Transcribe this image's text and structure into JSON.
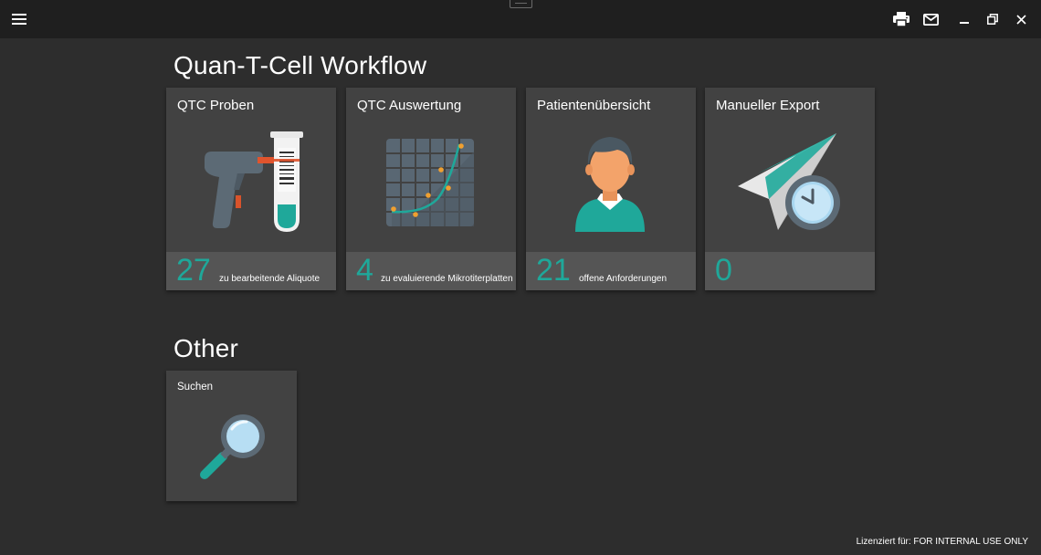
{
  "titlebar": {
    "menu_icon": "hamburger-icon",
    "actions": [
      {
        "name": "print-icon"
      },
      {
        "name": "mail-icon"
      },
      {
        "name": "minimize-icon"
      },
      {
        "name": "restore-icon"
      },
      {
        "name": "close-icon"
      }
    ]
  },
  "sections": {
    "workflow": {
      "title": "Quan-T-Cell Workflow",
      "tiles": [
        {
          "title": "QTC Proben",
          "count": "27",
          "subtitle": "zu bearbeitende Aliquote",
          "icon": "barcode-scanner-test-tube-icon"
        },
        {
          "title": "QTC Auswertung",
          "count": "4",
          "subtitle": "zu evaluierende Mikrotiterplatten",
          "icon": "chart-grid-icon"
        },
        {
          "title": "Patientenübersicht",
          "count": "21",
          "subtitle": "offene Anforderungen",
          "icon": "patient-avatar-icon"
        },
        {
          "title": "Manueller Export",
          "count": "0",
          "subtitle": "",
          "icon": "paper-plane-clock-icon"
        }
      ]
    },
    "other": {
      "title": "Other",
      "tiles": [
        {
          "title": "Suchen",
          "icon": "magnifier-icon"
        }
      ]
    }
  },
  "footer": {
    "license": "Lizenziert für: FOR INTERNAL USE ONLY"
  },
  "colors": {
    "background": "#2d2d2d",
    "titlebar": "#1f1f1f",
    "tile": "#424242",
    "tile_footer": "#555555",
    "accent": "#1fa89a"
  }
}
